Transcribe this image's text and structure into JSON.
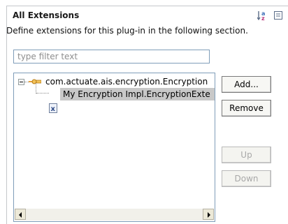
{
  "section": {
    "title": "All Extensions",
    "description": "Define extensions for this plug-in in the following section.",
    "sort_icon": "sort-alphabetical-icon",
    "collapse_icon": "collapse-all-icon"
  },
  "filter": {
    "placeholder": "type filter text",
    "value": ""
  },
  "tree": {
    "items": [
      {
        "label": "com.actuate.ais.encryption.Encryption",
        "icon": "extension-point-icon",
        "expanded": true
      },
      {
        "label": "My Encryption Impl.EncryptionExte",
        "icon": "xml-element-icon",
        "selected": true
      }
    ]
  },
  "buttons": {
    "add": "Add...",
    "remove": "Remove",
    "up": "Up",
    "down": "Down"
  },
  "colors": {
    "selection": "#c8c8c8",
    "border": "#7f9db9",
    "disabled_text": "#a8a8a8"
  }
}
